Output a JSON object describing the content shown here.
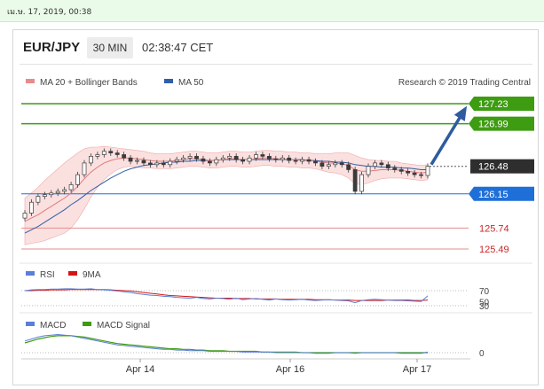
{
  "header": {
    "date_bar": "เม.ษ. 17, 2019, 00:38",
    "pair": "EUR/JPY",
    "timeframe": "30 MIN",
    "time": "02:38:47 CET"
  },
  "chart_data": [
    {
      "type": "line",
      "panel": "price",
      "legend": [
        "MA 20 + Bollinger Bands",
        "MA 50"
      ],
      "source_note": "Research © 2019 Trading Central",
      "x_ticks": [
        "Apr 14",
        "Apr 16",
        "Apr 17"
      ],
      "ylim": [
        125.4,
        127.3
      ],
      "levels": [
        {
          "value": 127.23,
          "label": "127.23",
          "kind": "resistance"
        },
        {
          "value": 126.99,
          "label": "126.99",
          "kind": "resistance"
        },
        {
          "value": 126.48,
          "label": "126.48",
          "kind": "current"
        },
        {
          "value": 126.15,
          "label": "126.15",
          "kind": "pivot"
        },
        {
          "value": 125.74,
          "label": "125.74",
          "kind": "support"
        },
        {
          "value": 125.49,
          "label": "125.49",
          "kind": "support"
        }
      ],
      "close": [
        125.92,
        126.05,
        126.12,
        126.14,
        126.16,
        126.18,
        126.2,
        126.26,
        126.38,
        126.52,
        126.6,
        126.62,
        126.66,
        126.64,
        126.62,
        126.58,
        126.54,
        126.55,
        126.52,
        126.5,
        126.52,
        126.5,
        126.54,
        126.56,
        126.58,
        126.6,
        126.57,
        126.54,
        126.52,
        126.56,
        126.58,
        126.6,
        126.56,
        126.54,
        126.58,
        126.62,
        126.6,
        126.57,
        126.56,
        126.58,
        126.55,
        126.54,
        126.56,
        126.54,
        126.52,
        126.48,
        126.5,
        126.52,
        126.5,
        126.44,
        126.18,
        126.38,
        126.48,
        126.52,
        126.5,
        126.46,
        126.44,
        126.42,
        126.4,
        126.38,
        126.37,
        126.48
      ],
      "ma20": [
        125.82,
        125.86,
        125.9,
        125.95,
        126.0,
        126.05,
        126.1,
        126.16,
        126.24,
        126.33,
        126.41,
        126.47,
        126.52,
        126.55,
        126.57,
        126.58,
        126.58,
        126.57,
        126.56,
        126.55,
        126.54,
        126.54,
        126.54,
        126.55,
        126.56,
        126.57,
        126.57,
        126.56,
        126.55,
        126.55,
        126.56,
        126.57,
        126.57,
        126.56,
        126.56,
        126.57,
        126.58,
        126.58,
        126.57,
        126.57,
        126.56,
        126.56,
        126.55,
        126.55,
        126.54,
        126.53,
        126.52,
        126.52,
        126.51,
        126.49,
        126.44,
        126.42,
        126.42,
        126.43,
        126.44,
        126.44,
        126.44,
        126.43,
        126.42,
        126.41,
        126.4,
        126.41
      ],
      "ma50": [
        125.68,
        125.72,
        125.76,
        125.81,
        125.86,
        125.91,
        125.96,
        126.02,
        126.07,
        126.13,
        126.19,
        126.24,
        126.29,
        126.34,
        126.38,
        126.42,
        126.45,
        126.47,
        126.49,
        126.5,
        126.51,
        126.52,
        126.53,
        126.53,
        126.54,
        126.54,
        126.55,
        126.55,
        126.55,
        126.55,
        126.56,
        126.56,
        126.56,
        126.56,
        126.56,
        126.56,
        126.56,
        126.56,
        126.56,
        126.56,
        126.56,
        126.56,
        126.56,
        126.55,
        126.55,
        126.54,
        126.54,
        126.53,
        126.53,
        126.52,
        126.5,
        126.49,
        126.48,
        126.48,
        126.47,
        126.47,
        126.47,
        126.46,
        126.46,
        126.45,
        126.44,
        126.44
      ],
      "band_width": [
        0.28,
        0.3,
        0.33,
        0.36,
        0.38,
        0.4,
        0.42,
        0.42,
        0.4,
        0.36,
        0.3,
        0.24,
        0.2,
        0.16,
        0.13,
        0.11,
        0.1,
        0.1,
        0.1,
        0.09,
        0.09,
        0.09,
        0.09,
        0.09,
        0.09,
        0.09,
        0.09,
        0.09,
        0.09,
        0.09,
        0.09,
        0.09,
        0.09,
        0.09,
        0.09,
        0.09,
        0.09,
        0.09,
        0.09,
        0.09,
        0.09,
        0.09,
        0.09,
        0.09,
        0.09,
        0.1,
        0.11,
        0.12,
        0.13,
        0.15,
        0.17,
        0.16,
        0.14,
        0.12,
        0.11,
        0.1,
        0.1,
        0.09,
        0.09,
        0.09,
        0.09,
        0.09
      ],
      "colors": {
        "bands": "#f7c6c6",
        "ma20": "#e07b7b",
        "ma50": "#2f5fa8",
        "candle": "#3a3a3a",
        "resistance": "#3e9c12",
        "support": "#e48e8e",
        "pivot": "#1f6fd9",
        "current": "#333333",
        "arrow": "#2f5b9f"
      }
    },
    {
      "type": "line",
      "panel": "rsi",
      "legend": [
        "RSI",
        "9MA"
      ],
      "y_ticks": [
        "70",
        "50",
        "30"
      ],
      "ylim": [
        20,
        80
      ],
      "rsi": [
        70,
        72,
        73,
        73,
        74,
        74,
        75,
        75,
        74,
        74,
        75,
        73,
        72,
        71,
        69,
        67,
        65,
        62,
        60,
        58,
        57,
        55,
        54,
        52,
        51,
        50,
        52,
        49,
        48,
        50,
        49,
        47,
        50,
        46,
        48,
        49,
        47,
        45,
        48,
        46,
        45,
        46,
        47,
        45,
        44,
        45,
        46,
        45,
        44,
        43,
        38,
        44,
        46,
        47,
        46,
        45,
        44,
        44,
        43,
        42,
        41,
        56
      ],
      "ma9": [
        70,
        70,
        71,
        71,
        72,
        72,
        72,
        73,
        73,
        73,
        73,
        73,
        73,
        72,
        71,
        70,
        69,
        67,
        65,
        63,
        61,
        59,
        57,
        56,
        55,
        54,
        53,
        52,
        51,
        50,
        50,
        50,
        49,
        49,
        49,
        48,
        48,
        48,
        48,
        47,
        47,
        47,
        47,
        47,
        46,
        46,
        46,
        45,
        45,
        45,
        44,
        44,
        44,
        44,
        44,
        45,
        45,
        45,
        45,
        44,
        44,
        45
      ],
      "colors": {
        "rsi": "#5b7fd8",
        "ma9": "#d31515"
      }
    },
    {
      "type": "line",
      "panel": "macd",
      "legend": [
        "MACD",
        "MACD Signal"
      ],
      "y_ticks": [
        "0"
      ],
      "ylim": [
        -0.05,
        0.35
      ],
      "macd": [
        0.18,
        0.21,
        0.24,
        0.26,
        0.27,
        0.28,
        0.27,
        0.26,
        0.24,
        0.22,
        0.2,
        0.18,
        0.16,
        0.14,
        0.12,
        0.11,
        0.1,
        0.09,
        0.08,
        0.07,
        0.06,
        0.05,
        0.05,
        0.04,
        0.04,
        0.03,
        0.03,
        0.03,
        0.02,
        0.02,
        0.02,
        0.02,
        0.02,
        0.01,
        0.01,
        0.01,
        0.01,
        0.01,
        0.0,
        0.0,
        0.0,
        0.0,
        0.0,
        0.0,
        -0.01,
        -0.01,
        -0.01,
        0.0,
        0.0,
        0.0,
        -0.01,
        0.0,
        0.0,
        0.0,
        0.0,
        0.0,
        0.0,
        -0.01,
        -0.01,
        -0.01,
        -0.01,
        0.01
      ],
      "signal": [
        0.15,
        0.18,
        0.21,
        0.23,
        0.25,
        0.26,
        0.26,
        0.26,
        0.25,
        0.24,
        0.22,
        0.2,
        0.18,
        0.16,
        0.14,
        0.13,
        0.12,
        0.11,
        0.1,
        0.09,
        0.08,
        0.07,
        0.06,
        0.06,
        0.05,
        0.05,
        0.04,
        0.04,
        0.03,
        0.03,
        0.03,
        0.02,
        0.02,
        0.02,
        0.02,
        0.02,
        0.01,
        0.01,
        0.01,
        0.01,
        0.01,
        0.01,
        0.0,
        0.0,
        0.0,
        0.0,
        0.0,
        0.0,
        0.0,
        0.0,
        0.0,
        0.0,
        0.0,
        0.0,
        0.0,
        0.0,
        0.0,
        0.0,
        0.0,
        0.0,
        0.0,
        0.0
      ],
      "colors": {
        "macd": "#5b7fd8",
        "signal": "#3e9c12"
      }
    }
  ]
}
